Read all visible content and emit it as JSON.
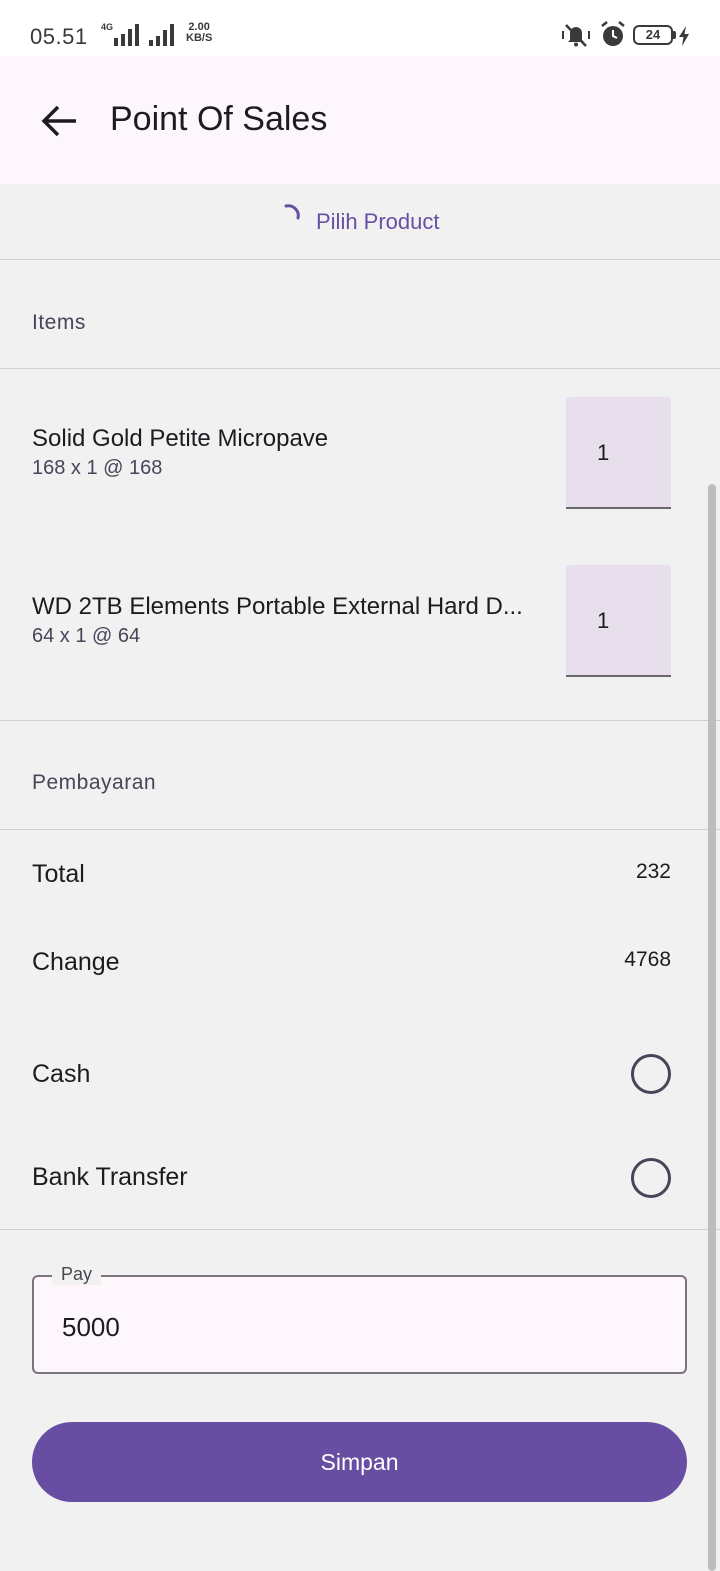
{
  "status_bar": {
    "time": "05.51",
    "network": "4G",
    "speed_value": "2.00",
    "speed_unit": "KB/S",
    "battery": "24"
  },
  "app_bar": {
    "title": "Point Of Sales"
  },
  "product_picker": {
    "label": "Pilih Product"
  },
  "items_section": {
    "label": "Items",
    "items": [
      {
        "name": "Solid Gold Petite Micropave",
        "detail": "168 x 1 @ 168",
        "qty": "1"
      },
      {
        "name": "WD 2TB Elements Portable External Hard D...",
        "detail": "64 x 1 @ 64",
        "qty": "1"
      }
    ]
  },
  "payment_section": {
    "label": "Pembayaran",
    "total_label": "Total",
    "total_value": "232",
    "change_label": "Change",
    "change_value": "4768",
    "methods": [
      {
        "label": "Cash",
        "selected": false
      },
      {
        "label": "Bank Transfer",
        "selected": false
      }
    ]
  },
  "pay_field": {
    "label": "Pay",
    "value": "5000"
  },
  "save_button": {
    "label": "Simpan"
  },
  "colors": {
    "primary": "#674ea2",
    "app_bar_bg": "#fdf7fb",
    "page_bg": "#f1f1f1",
    "qty_bg": "#e7e0ec"
  }
}
